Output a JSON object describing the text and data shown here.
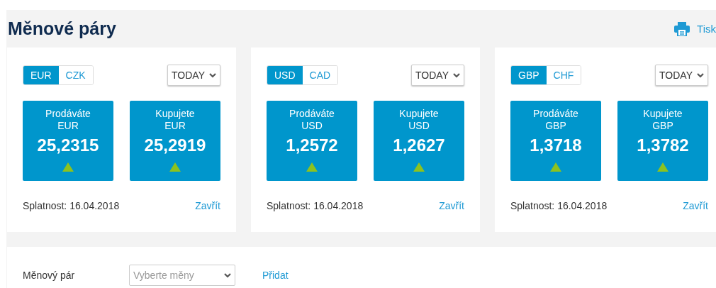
{
  "header": {
    "title": "Měnové páry",
    "print_label": "Tisk"
  },
  "pairs": [
    {
      "currencies": [
        {
          "code": "EUR",
          "selected": true
        },
        {
          "code": "CZK",
          "selected": false
        }
      ],
      "period": "TODAY",
      "quotes": [
        {
          "label": "Prodáváte",
          "currency": "EUR",
          "rate": "25,2315",
          "rising": true
        },
        {
          "label": "Kupujete",
          "currency": "EUR",
          "rate": "25,2919",
          "rising": true
        }
      ],
      "settlement": "Splatnost: 16.04.2018",
      "close": "Zavřít"
    },
    {
      "currencies": [
        {
          "code": "USD",
          "selected": true
        },
        {
          "code": "CAD",
          "selected": false
        }
      ],
      "period": "TODAY",
      "quotes": [
        {
          "label": "Prodáváte",
          "currency": "USD",
          "rate": "1,2572",
          "rising": true
        },
        {
          "label": "Kupujete",
          "currency": "USD",
          "rate": "1,2627",
          "rising": true
        }
      ],
      "settlement": "Splatnost: 16.04.2018",
      "close": "Zavřít"
    },
    {
      "currencies": [
        {
          "code": "GBP",
          "selected": true
        },
        {
          "code": "CHF",
          "selected": false
        }
      ],
      "period": "TODAY",
      "quotes": [
        {
          "label": "Prodáváte",
          "currency": "GBP",
          "rate": "1,3718",
          "rising": true
        },
        {
          "label": "Kupujete",
          "currency": "GBP",
          "rate": "1,3782",
          "rising": true
        }
      ],
      "settlement": "Splatnost: 16.04.2018",
      "close": "Zavřít"
    }
  ],
  "add_pair": {
    "label": "Měnový pár",
    "placeholder": "Vyberte měny",
    "button": "Přidat"
  }
}
